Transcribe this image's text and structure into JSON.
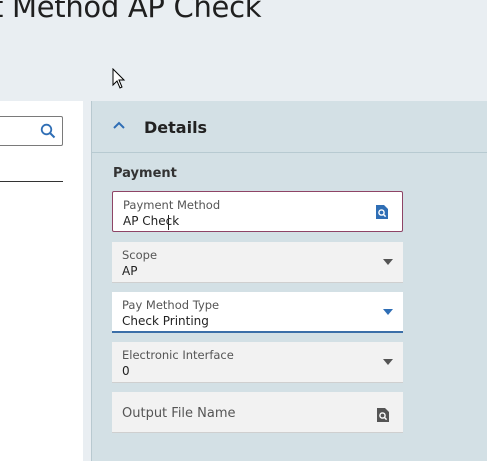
{
  "header": {
    "title": "t Method AP Check"
  },
  "details": {
    "title": "Details",
    "section_label": "Payment",
    "fields": {
      "payment_method": {
        "label": "Payment Method",
        "value": "AP Check"
      },
      "scope": {
        "label": "Scope",
        "value": "AP"
      },
      "pay_method_type": {
        "label": "Pay Method Type",
        "value": "Check Printing"
      },
      "electronic_interface": {
        "label": "Electronic Interface",
        "value": "0"
      },
      "output_file_name": {
        "placeholder": "Output File Name"
      }
    }
  },
  "colors": {
    "accent_active_border": "#8e4466",
    "accent_selected_underline": "#3b6fa8",
    "details_background": "#d3e0e5",
    "icon_blue": "#2f6eb5"
  },
  "icons": [
    "search-icon",
    "chevron-up-icon",
    "lookup-icon",
    "chevron-down-icon",
    "mouse-cursor-icon"
  ]
}
